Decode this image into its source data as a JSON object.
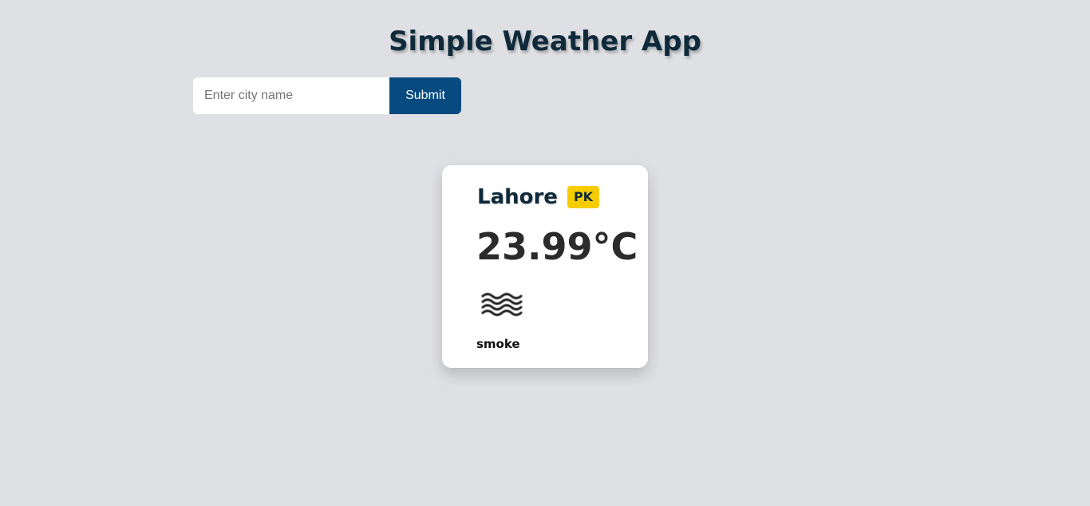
{
  "header": {
    "title": "Simple Weather App"
  },
  "search": {
    "placeholder": "Enter city name",
    "value": "",
    "submit_label": "Submit"
  },
  "weather": {
    "city": "Lahore",
    "country": "PK",
    "temperature": "23.99°C",
    "icon": "smoke-haze-icon",
    "description": "smoke"
  },
  "colors": {
    "background": "#dfe0e4",
    "submit_button": "#064a80",
    "badge": "#f7cc00",
    "title": "#0e2a3b"
  }
}
